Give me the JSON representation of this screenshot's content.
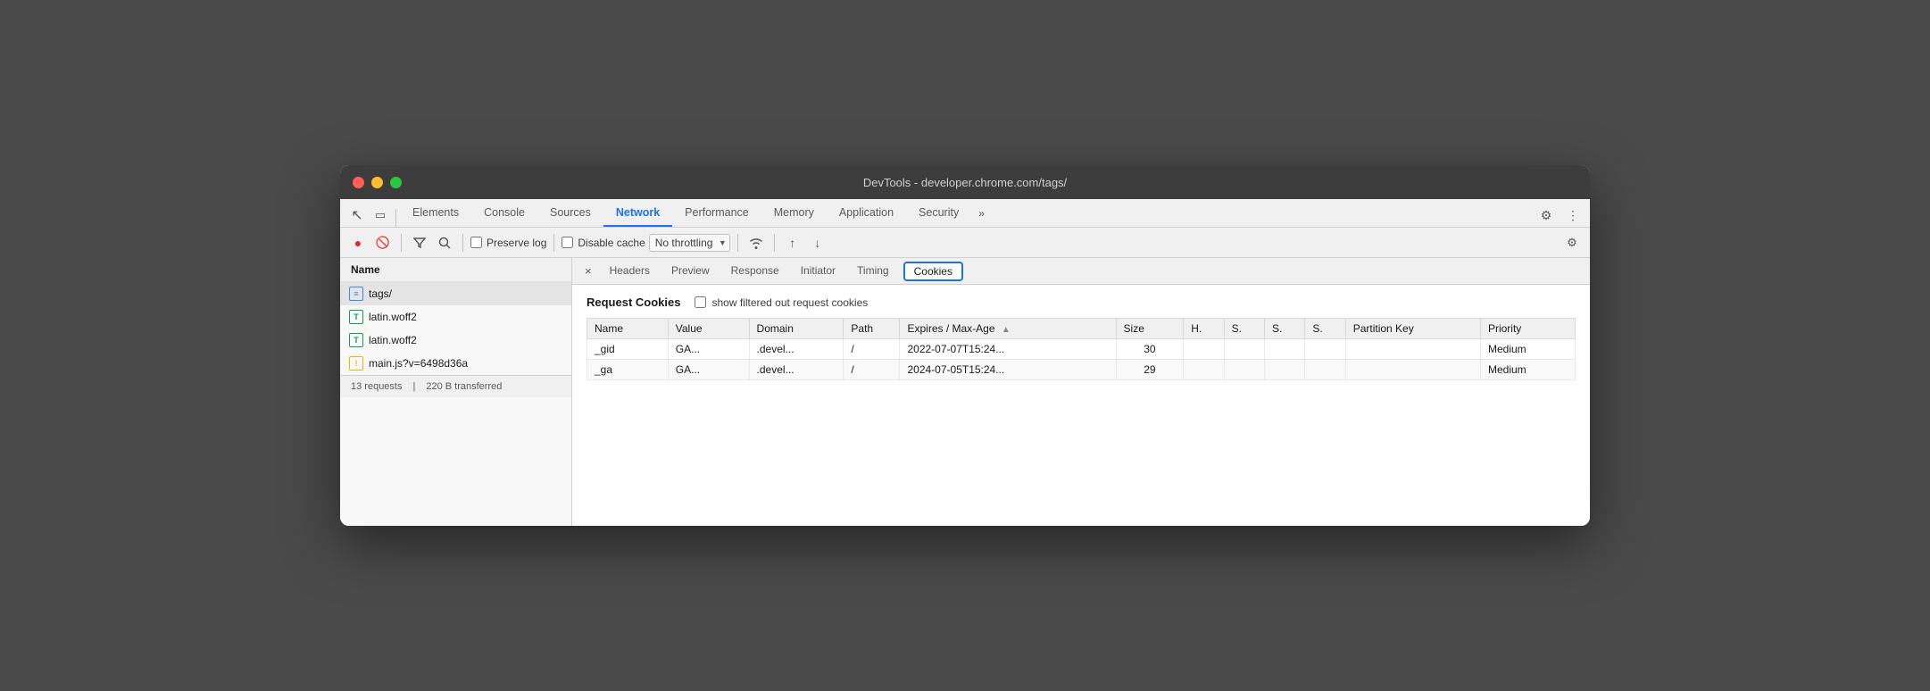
{
  "window": {
    "title": "DevTools - developer.chrome.com/tags/"
  },
  "traffic_lights": {
    "close": "close",
    "minimize": "minimize",
    "maximize": "maximize"
  },
  "tabs": {
    "items": [
      {
        "label": "Elements",
        "active": false
      },
      {
        "label": "Console",
        "active": false
      },
      {
        "label": "Sources",
        "active": false
      },
      {
        "label": "Network",
        "active": true
      },
      {
        "label": "Performance",
        "active": false
      },
      {
        "label": "Memory",
        "active": false
      },
      {
        "label": "Application",
        "active": false
      },
      {
        "label": "Security",
        "active": false
      }
    ],
    "more": "»",
    "gear_label": "⚙",
    "more_vert_label": "⋮"
  },
  "secondary_toolbar": {
    "record_label": "●",
    "block_label": "🚫",
    "filter_label": "▽",
    "search_label": "🔍",
    "preserve_log": "Preserve log",
    "disable_cache": "Disable cache",
    "throttle": "No throttling",
    "wifi_label": "📶",
    "upload_label": "↑",
    "download_label": "↓",
    "settings_label": "⚙"
  },
  "file_list": {
    "header": "Name",
    "items": [
      {
        "name": "tags/",
        "type": "doc",
        "selected": true
      },
      {
        "name": "latin.woff2",
        "type": "font1"
      },
      {
        "name": "latin.woff2",
        "type": "font2"
      },
      {
        "name": "main.js?v=6498d36a",
        "type": "js"
      }
    ],
    "status": {
      "requests": "13 requests",
      "transferred": "220 B transferred"
    }
  },
  "detail": {
    "tabs": [
      {
        "label": "×",
        "is_close": true
      },
      {
        "label": "Headers"
      },
      {
        "label": "Preview"
      },
      {
        "label": "Response"
      },
      {
        "label": "Initiator"
      },
      {
        "label": "Timing"
      },
      {
        "label": "Cookies",
        "active": true
      }
    ]
  },
  "cookies": {
    "request_cookies_title": "Request Cookies",
    "show_filtered_label": "show filtered out request cookies",
    "table": {
      "columns": [
        {
          "key": "name",
          "label": "Name"
        },
        {
          "key": "value",
          "label": "Value"
        },
        {
          "key": "domain",
          "label": "Domain"
        },
        {
          "key": "path",
          "label": "Path"
        },
        {
          "key": "expires",
          "label": "Expires / Max-Age",
          "sorted": true,
          "sort_dir": "asc"
        },
        {
          "key": "size",
          "label": "Size"
        },
        {
          "key": "h",
          "label": "H."
        },
        {
          "key": "s1",
          "label": "S."
        },
        {
          "key": "s2",
          "label": "S."
        },
        {
          "key": "s3",
          "label": "S."
        },
        {
          "key": "partition_key",
          "label": "Partition Key"
        },
        {
          "key": "priority",
          "label": "Priority"
        }
      ],
      "rows": [
        {
          "name": "_gid",
          "value": "GA...",
          "domain": ".devel...",
          "path": "/",
          "expires": "2022-07-07T15:24...",
          "size": "30",
          "h": "",
          "s1": "",
          "s2": "",
          "s3": "",
          "partition_key": "",
          "priority": "Medium"
        },
        {
          "name": "_ga",
          "value": "GA...",
          "domain": ".devel...",
          "path": "/",
          "expires": "2024-07-05T15:24...",
          "size": "29",
          "h": "",
          "s1": "",
          "s2": "",
          "s3": "",
          "partition_key": "",
          "priority": "Medium"
        }
      ]
    }
  }
}
